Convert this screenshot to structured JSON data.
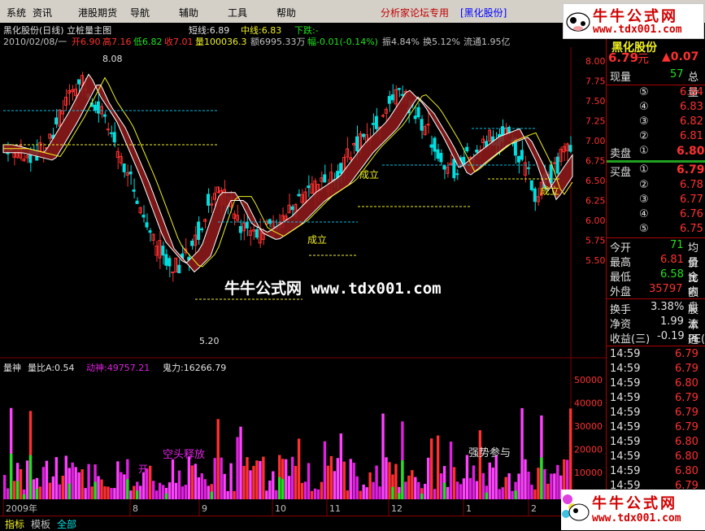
{
  "menu": {
    "items": [
      "系统",
      "资讯",
      "港股期货",
      "导航",
      "辅助",
      "工具",
      "帮助"
    ],
    "title": "分析家论坛专用",
    "stock_tag": "[黑化股份]"
  },
  "logo": {
    "name": "牛牛公式网",
    "url": "www.tdx001.com"
  },
  "chart_header": {
    "title": "黑化股份(日线) 立桩量主图",
    "short_line": "短线:6.89",
    "mid_line": "中线:6.83",
    "down": "下跌:-",
    "date": "2010/02/08/一",
    "open": "开6.90",
    "high": "高7.16",
    "low": "低6.82",
    "close": "收7.01",
    "volume": "量100036.3",
    "amount": "额6995.33万",
    "change": "幅-0.01(-0.14%)",
    "amplitude": "振4.84%",
    "turnover": "换5.12%",
    "float": "流通1.95亿"
  },
  "price_axis": [
    "8.00",
    "7.75",
    "7.50",
    "7.25",
    "7.00",
    "6.75",
    "6.50",
    "6.25",
    "6.00",
    "5.75",
    "5.50"
  ],
  "annotations": {
    "high_mark": "8.08",
    "low_mark": "5.20",
    "signal": "成立",
    "empty_release": "空头释放",
    "strong_join": "强势参与",
    "left_partial": "开",
    "watermark": "牛牛公式网 www.tdx001.com"
  },
  "volume_header": {
    "name": "量神",
    "ratio": "量比A:0.54",
    "power": "动神:49757.21",
    "ghost": "鬼力:16266.79"
  },
  "volume_axis": [
    "50000",
    "40000",
    "30000",
    "20000",
    "10000"
  ],
  "x_axis": [
    "2009年",
    "8",
    "9",
    "10",
    "11",
    "12",
    "1",
    "2"
  ],
  "bottom_tabs": [
    "指标",
    "模板",
    "全部"
  ],
  "quote": {
    "name_partial": "黑化股份",
    "price": "6.79",
    "unit": "元",
    "change": "▲0.07",
    "now_vol_label": "现量",
    "now_vol": "57",
    "total_label": "总量",
    "sell": [
      {
        "idx": "⑤",
        "price": "6.84"
      },
      {
        "idx": "④",
        "price": "6.83"
      },
      {
        "idx": "③",
        "price": "6.82"
      },
      {
        "idx": "②",
        "price": "6.81"
      },
      {
        "idx": "①",
        "price": "6.80",
        "label": "卖盘"
      }
    ],
    "buy": [
      {
        "idx": "①",
        "price": "6.79",
        "label": "买盘"
      },
      {
        "idx": "②",
        "price": "6.78"
      },
      {
        "idx": "③",
        "price": "6.77"
      },
      {
        "idx": "④",
        "price": "6.76"
      },
      {
        "idx": "⑤",
        "price": "6.75"
      }
    ],
    "stats": [
      {
        "label": "今开",
        "value": "71",
        "right": "均价"
      },
      {
        "label": "最高",
        "value": "6.81",
        "right": "量比"
      },
      {
        "label": "最低",
        "value": "6.58",
        "right": "金额"
      },
      {
        "label": "外盘",
        "value": "35797",
        "right": "内盘"
      },
      {
        "label": "换手",
        "value": "3.38%",
        "right": "股本"
      },
      {
        "label": "净资",
        "value": "1.99",
        "right": "流通"
      },
      {
        "label": "收益(三)",
        "value": "-0.19",
        "right": "PE(动)"
      }
    ],
    "ticks": [
      {
        "time": "14:59",
        "price": "6.79"
      },
      {
        "time": "14:59",
        "price": "6.79"
      },
      {
        "time": "14:59",
        "price": "6.80"
      },
      {
        "time": "14:59",
        "price": "6.79"
      },
      {
        "time": "14:59",
        "price": "6.79"
      },
      {
        "time": "14:59",
        "price": "6.79"
      },
      {
        "time": "14:59",
        "price": "6.80"
      },
      {
        "time": "14:59",
        "price": "6.80"
      },
      {
        "time": "14:59",
        "price": "6.80"
      },
      {
        "time": "14:59",
        "price": "6.79"
      },
      {
        "time": "14:59",
        "price": "6.79"
      }
    ]
  },
  "colors": {
    "up": "#ff3030",
    "down": "#00e0e0",
    "ribbon": "#8b1a1a",
    "ma_line": "#f0f020",
    "volume_magenta": "#e020e0"
  }
}
